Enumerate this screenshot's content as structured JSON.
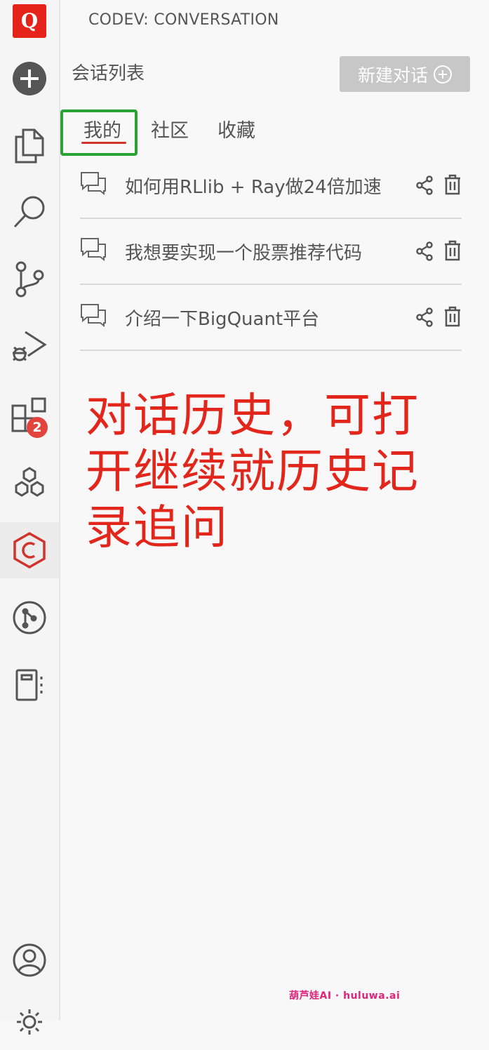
{
  "app": {
    "logo_letter": "Q",
    "extensions_badge": "2"
  },
  "panel": {
    "title": "CODEV: CONVERSATION",
    "section_title": "会话列表",
    "new_button_label": "新建对话"
  },
  "tabs": [
    {
      "label": "我的",
      "active": true
    },
    {
      "label": "社区",
      "active": false
    },
    {
      "label": "收藏",
      "active": false
    }
  ],
  "conversations": [
    {
      "title": "如何用RLlib + Ray做24倍加速"
    },
    {
      "title": "我想要实现一个股票推荐代码"
    },
    {
      "title": "介绍一下BigQuant平台"
    }
  ],
  "annotation": "对话历史，可打开继续就历史记录追问",
  "watermark": "葫芦娃AI · huluwa.ai",
  "colors": {
    "brand_red": "#e5231b",
    "annotation_red": "#e3261c",
    "highlight_green": "#2aa334",
    "tab_underline": "#d0342c",
    "button_gray": "#c7c7c7"
  },
  "icons": {
    "activity_bar": [
      "logo",
      "add-circle-icon",
      "files-icon",
      "search-icon",
      "source-control-icon",
      "run-debug-icon",
      "extensions-icon",
      "cubes-icon",
      "codev-icon",
      "git-graph-icon",
      "notebook-icon",
      "account-icon",
      "settings-icon"
    ],
    "conversation_row": [
      "chat-icon",
      "share-icon",
      "trash-icon"
    ]
  }
}
